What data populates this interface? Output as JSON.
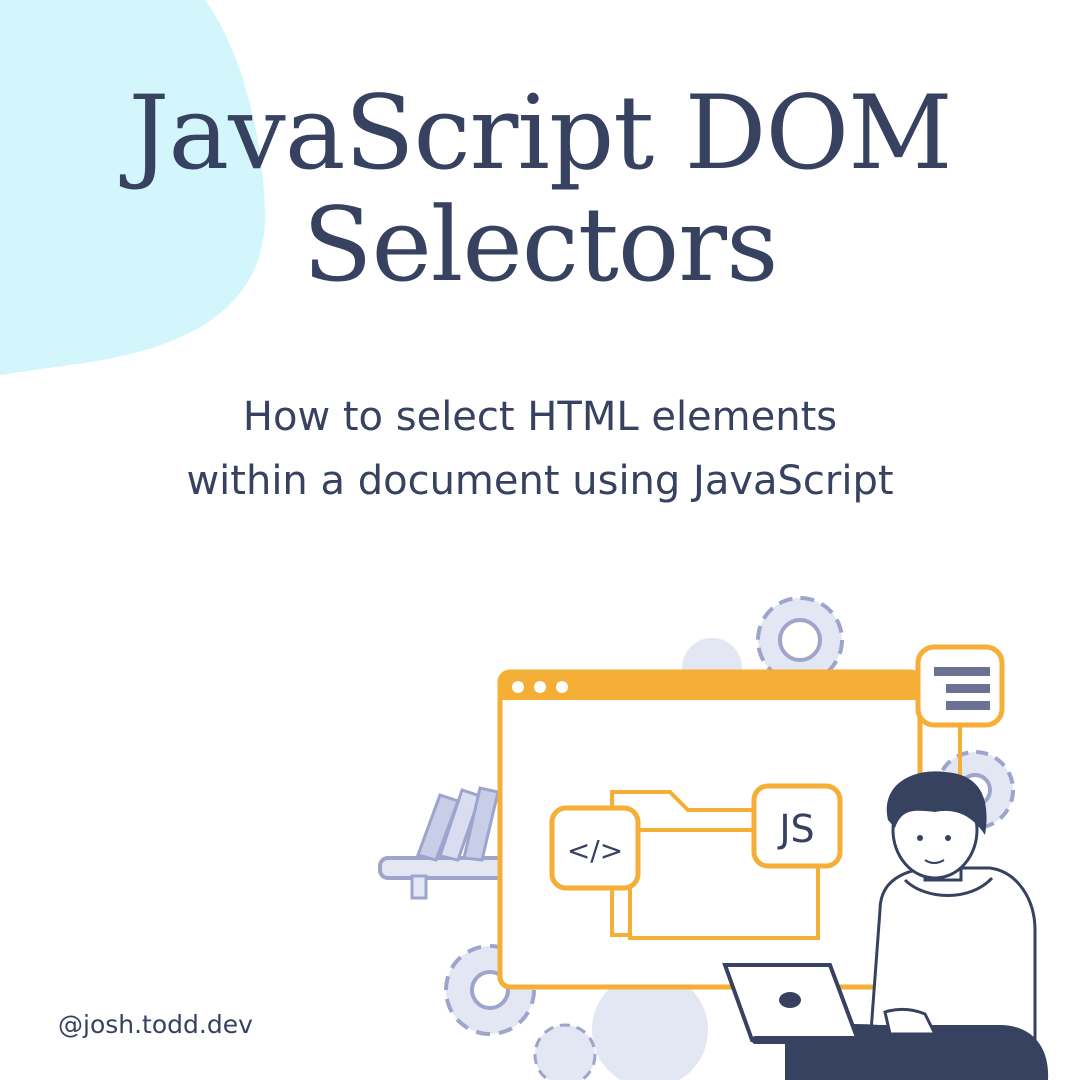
{
  "title": {
    "line1": "JavaScript DOM",
    "line2": "Selectors"
  },
  "subtitle": {
    "line1": "How to select HTML elements",
    "line2": "within a document using JavaScript"
  },
  "handle": "@josh.todd.dev",
  "illustration": {
    "code_tag": "</>",
    "js_badge": "JS"
  },
  "colors": {
    "heading": "#374260",
    "accent": "#F5AE36",
    "blob": "#D3F6FC",
    "gear": "#C9CEE8",
    "background": "#FFFFFF"
  },
  "icons": [
    "gear-icon",
    "browser-window",
    "folder-icon",
    "code-icon",
    "js-badge",
    "menu-icon",
    "laptop-icon",
    "books-icon",
    "developer-person"
  ]
}
